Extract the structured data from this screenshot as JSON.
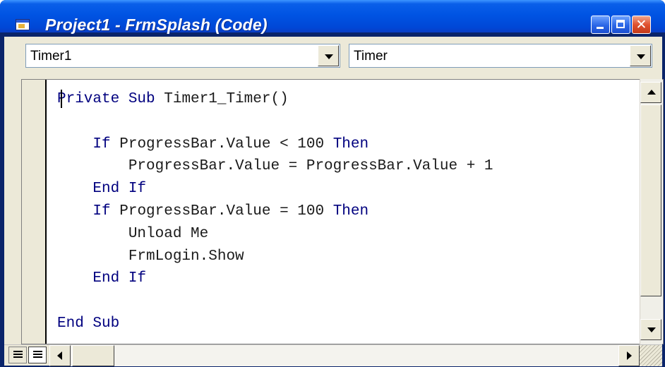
{
  "window": {
    "title": "Project1 - FrmSplash (Code)",
    "icon": "vb-code-window-icon",
    "controls": {
      "minimize_icon": "minimize-icon",
      "maximize_icon": "maximize-icon",
      "close_icon": "close-icon",
      "close_glyph": "✕"
    }
  },
  "toolbar": {
    "object_combo": {
      "value": "Timer1",
      "icon": "chevron-down-icon"
    },
    "procedure_combo": {
      "value": "Timer",
      "icon": "chevron-down-icon"
    }
  },
  "code": {
    "lines": [
      "Private Sub Timer1_Timer()",
      "",
      "    If ProgressBar.Value < 100 Then",
      "        ProgressBar.Value = ProgressBar.Value + 1",
      "    End If",
      "    If ProgressBar.Value = 100 Then",
      "        Unload Me",
      "        FrmLogin.Show",
      "    End If",
      "",
      "End Sub"
    ]
  },
  "statusbar": {
    "procedure_view_icon": "procedure-view-icon",
    "full_module_view_icon": "full-module-view-icon"
  },
  "colors": {
    "titlebar": "#0054e3",
    "keyword": "#00007f",
    "window_face": "#ece9d8"
  }
}
